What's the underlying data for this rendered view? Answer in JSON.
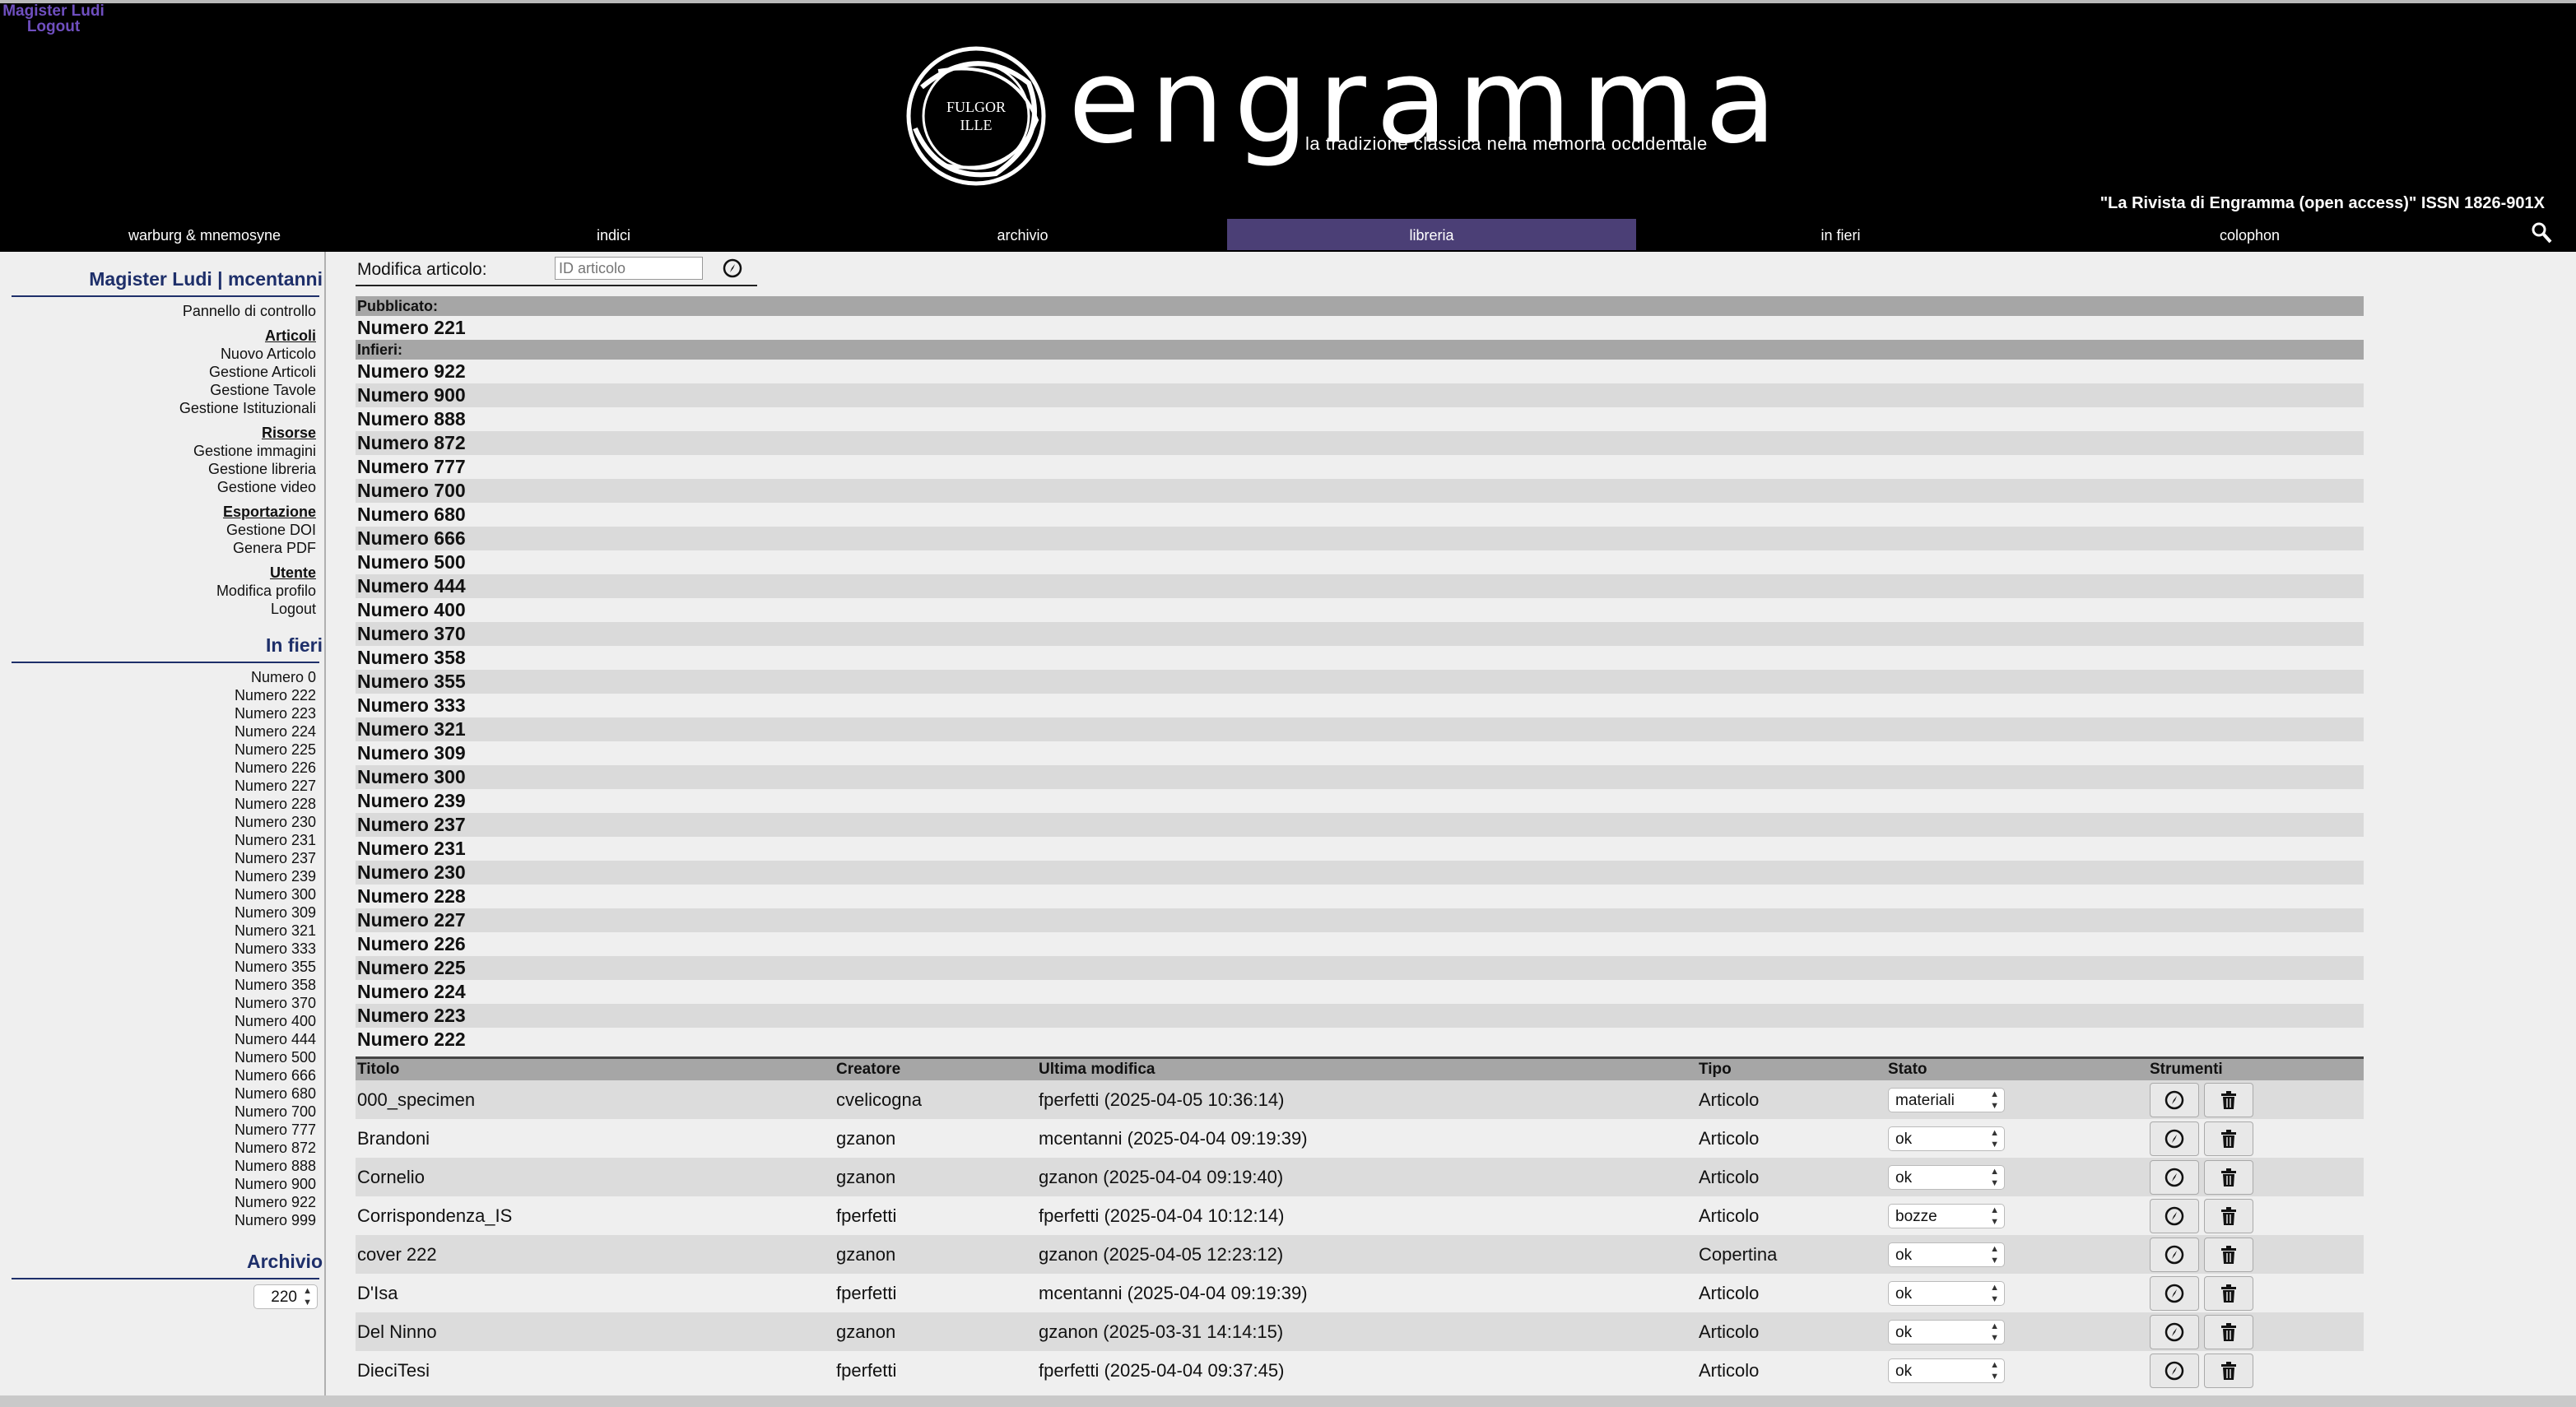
{
  "user_links": [
    "Magister Ludi",
    "Logout"
  ],
  "header": {
    "emblem_text": [
      "FULGOR",
      "ILLE"
    ],
    "title": "engramma",
    "subtitle": "la tradizione classica nella memoria occidentale",
    "issn": "\"La Rivista di Engramma (open access)\" ISSN 1826-901X"
  },
  "nav": [
    {
      "label": "warburg & mnemosyne",
      "active": false
    },
    {
      "label": "indici",
      "active": false
    },
    {
      "label": "archivio",
      "active": false
    },
    {
      "label": "libreria",
      "active": true
    },
    {
      "label": "in fieri",
      "active": false
    },
    {
      "label": "colophon",
      "active": false
    }
  ],
  "sidebar": {
    "user_title": "Magister Ludi | mcentanni",
    "control_panel": "Pannello di controllo",
    "sections": [
      {
        "title": "Articoli",
        "items": [
          "Nuovo Articolo",
          "Gestione Articoli",
          "Gestione Tavole",
          "Gestione Istituzionali"
        ]
      },
      {
        "title": "Risorse",
        "items": [
          "Gestione immagini",
          "Gestione libreria",
          "Gestione video"
        ]
      },
      {
        "title": "Esportazione",
        "items": [
          "Gestione DOI",
          "Genera PDF"
        ]
      },
      {
        "title": "Utente",
        "items": [
          "Modifica profilo",
          "Logout"
        ]
      }
    ],
    "in_fieri_title": "In fieri",
    "in_fieri": [
      "Numero 0",
      "Numero 222",
      "Numero 223",
      "Numero 224",
      "Numero 225",
      "Numero 226",
      "Numero 227",
      "Numero 228",
      "Numero 230",
      "Numero 231",
      "Numero 237",
      "Numero 239",
      "Numero 300",
      "Numero 309",
      "Numero 321",
      "Numero 333",
      "Numero 355",
      "Numero 358",
      "Numero 370",
      "Numero 400",
      "Numero 444",
      "Numero 500",
      "Numero 666",
      "Numero 680",
      "Numero 700",
      "Numero 777",
      "Numero 872",
      "Numero 888",
      "Numero 900",
      "Numero 922",
      "Numero 999"
    ],
    "archivio_title": "Archivio",
    "archivio_value": "220"
  },
  "modifica": {
    "label": "Modifica articolo:",
    "placeholder": "ID articolo"
  },
  "issues": {
    "published_label": "Pubblicato:",
    "published": [
      "Numero 221"
    ],
    "infieri_label": "Infieri:",
    "infieri": [
      "Numero 922",
      "Numero 900",
      "Numero 888",
      "Numero 872",
      "Numero 777",
      "Numero 700",
      "Numero 680",
      "Numero 666",
      "Numero 500",
      "Numero 444",
      "Numero 400",
      "Numero 370",
      "Numero 358",
      "Numero 355",
      "Numero 333",
      "Numero 321",
      "Numero 309",
      "Numero 300",
      "Numero 239",
      "Numero 237",
      "Numero 231",
      "Numero 230",
      "Numero 228",
      "Numero 227",
      "Numero 226",
      "Numero 225",
      "Numero 224",
      "Numero 223",
      "Numero 222"
    ]
  },
  "articles": {
    "columns": [
      "Titolo",
      "Creatore",
      "Ultima modifica",
      "Tipo",
      "Stato",
      "Strumenti"
    ],
    "rows": [
      {
        "titolo": "000_specimen",
        "creatore": "cvelicogna",
        "modifica": "fperfetti (2025-04-05 10:36:14)",
        "tipo": "Articolo",
        "stato": "materiali"
      },
      {
        "titolo": "Brandoni",
        "creatore": "gzanon",
        "modifica": "mcentanni (2025-04-04 09:19:39)",
        "tipo": "Articolo",
        "stato": "ok"
      },
      {
        "titolo": "Cornelio",
        "creatore": "gzanon",
        "modifica": "gzanon (2025-04-04 09:19:40)",
        "tipo": "Articolo",
        "stato": "ok"
      },
      {
        "titolo": "Corrispondenza_IS",
        "creatore": "fperfetti",
        "modifica": "fperfetti (2025-04-04 10:12:14)",
        "tipo": "Articolo",
        "stato": "bozze"
      },
      {
        "titolo": "cover 222",
        "creatore": "gzanon",
        "modifica": "gzanon (2025-04-05 12:23:12)",
        "tipo": "Copertina",
        "stato": "ok"
      },
      {
        "titolo": "D'Isa",
        "creatore": "fperfetti",
        "modifica": "mcentanni (2025-04-04 09:19:39)",
        "tipo": "Articolo",
        "stato": "ok"
      },
      {
        "titolo": "Del Ninno",
        "creatore": "gzanon",
        "modifica": "gzanon (2025-03-31 14:14:15)",
        "tipo": "Articolo",
        "stato": "ok"
      },
      {
        "titolo": "DieciTesi",
        "creatore": "fperfetti",
        "modifica": "fperfetti (2025-04-04 09:37:45)",
        "tipo": "Articolo",
        "stato": "ok"
      }
    ]
  }
}
